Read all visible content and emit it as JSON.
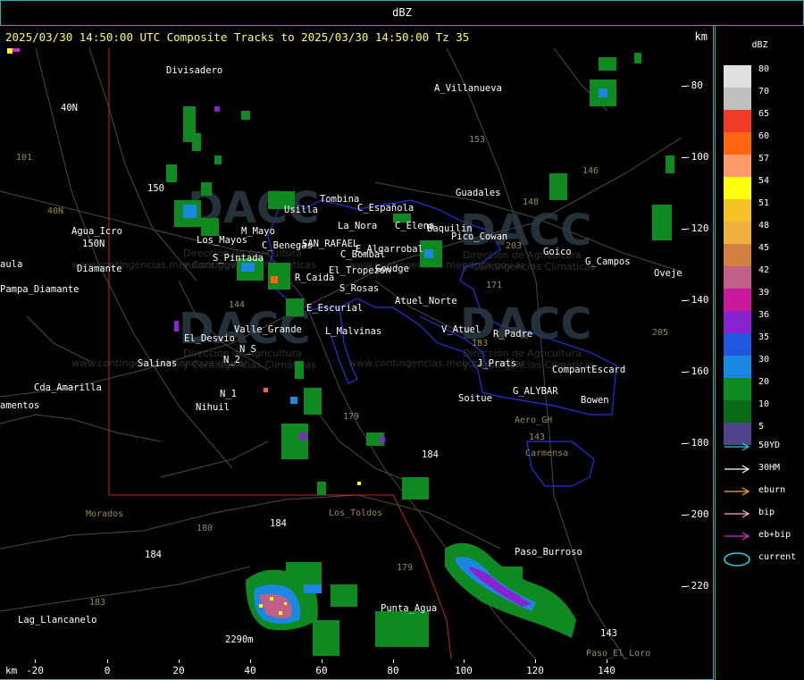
{
  "window": {
    "title": "dBZ"
  },
  "header": {
    "text": "2025/03/30 14:50:00 UTC Composite Tracks to 2025/03/30 14:50:00 Tz 35",
    "km_label": "km"
  },
  "y_axis": {
    "ticks": [
      "-80",
      "-100",
      "-120",
      "-140",
      "-160",
      "-180",
      "-200",
      "-220"
    ]
  },
  "x_axis": {
    "km_label": "km",
    "ticks": [
      "-20",
      "0",
      "20",
      "40",
      "60",
      "80",
      "100",
      "120",
      "140"
    ]
  },
  "legend": {
    "title": "dBZ",
    "scale": [
      {
        "value": "80",
        "color": "#e0e0e0"
      },
      {
        "value": "70",
        "color": "#c0c0c0"
      },
      {
        "value": "65",
        "color": "#f03a2a"
      },
      {
        "value": "60",
        "color": "#ff6510"
      },
      {
        "value": "57",
        "color": "#ff9a6a"
      },
      {
        "value": "54",
        "color": "#ffff10"
      },
      {
        "value": "51",
        "color": "#f5c22a"
      },
      {
        "value": "48",
        "color": "#f0b040"
      },
      {
        "value": "45",
        "color": "#d08040"
      },
      {
        "value": "42",
        "color": "#c06088"
      },
      {
        "value": "39",
        "color": "#c81a9a"
      },
      {
        "value": "36",
        "color": "#8a22d0"
      },
      {
        "value": "35",
        "color": "#2255e0"
      },
      {
        "value": "30",
        "color": "#1a88e0"
      },
      {
        "value": "20",
        "color": "#0e8a20"
      },
      {
        "value": "10",
        "color": "#0a6a18"
      },
      {
        "value": "5",
        "color": "#50458a"
      }
    ],
    "tracks": [
      {
        "label": "50YD",
        "color": "#22d0e0"
      },
      {
        "label": "30HM",
        "color": "#ffffff"
      },
      {
        "label": "eburn",
        "color": "#ffaa22"
      },
      {
        "label": "bip",
        "color": "#ffb0c0"
      },
      {
        "label": "eb+bip",
        "color": "#e020e0"
      },
      {
        "label": "current",
        "color": "#22d0e0"
      }
    ]
  },
  "map": {
    "places": [
      "Divisadero",
      "A_Villanueva",
      "40N",
      "101",
      "40N",
      "Agua_Icro",
      "150N",
      "150",
      "Usilla",
      "Tombina",
      "C_Española",
      "La_Nora",
      "C_Elena",
      "Baquilin",
      "Pico_Cowan",
      "Guadales",
      "153",
      "148",
      "146",
      "M_Mayo",
      "Los_Mayos",
      "C_Benegas",
      "SAN_RAFAEL",
      "E_Algarrobal",
      "C_Bombal",
      "S_Pintada",
      "R_Caida",
      "El_Tropezon",
      "Goudge",
      "S_Rosas",
      "Atuel_Norte",
      "Goico",
      "G_Campos",
      "Oveje",
      "aula",
      "Pampa_Diamante",
      "Diamante",
      "E_Escurial",
      "144",
      "Valle_Grande",
      "L_Malvinas",
      "V_Atuel",
      "R_Padre",
      "El_Desvio",
      "N_S",
      "N_2",
      "Salinas",
      "J_Prats",
      "CompantEscard",
      "Cda_Amarilla",
      "N_1",
      "Nihuil",
      "amentos",
      "G_ALYBAR",
      "Soitue",
      "Bowen",
      "Aero_GH",
      "143",
      "179",
      "184",
      "Carmensa",
      "Morados",
      "Los_Toldos",
      "180",
      "184",
      "184",
      "179",
      "Paso_Burroso",
      "183",
      "Lag_Llancanelo",
      "Punta_Agua",
      "2290m",
      "143",
      "Paso_El_Loro",
      "203",
      "171",
      "205",
      "183"
    ],
    "watermark": {
      "brand": "DACC",
      "line1": "Dirección de Agricultura",
      "line2": "y Contingencias Climáticas",
      "url": "www.contingencias.mendoza.gov.ar"
    }
  }
}
